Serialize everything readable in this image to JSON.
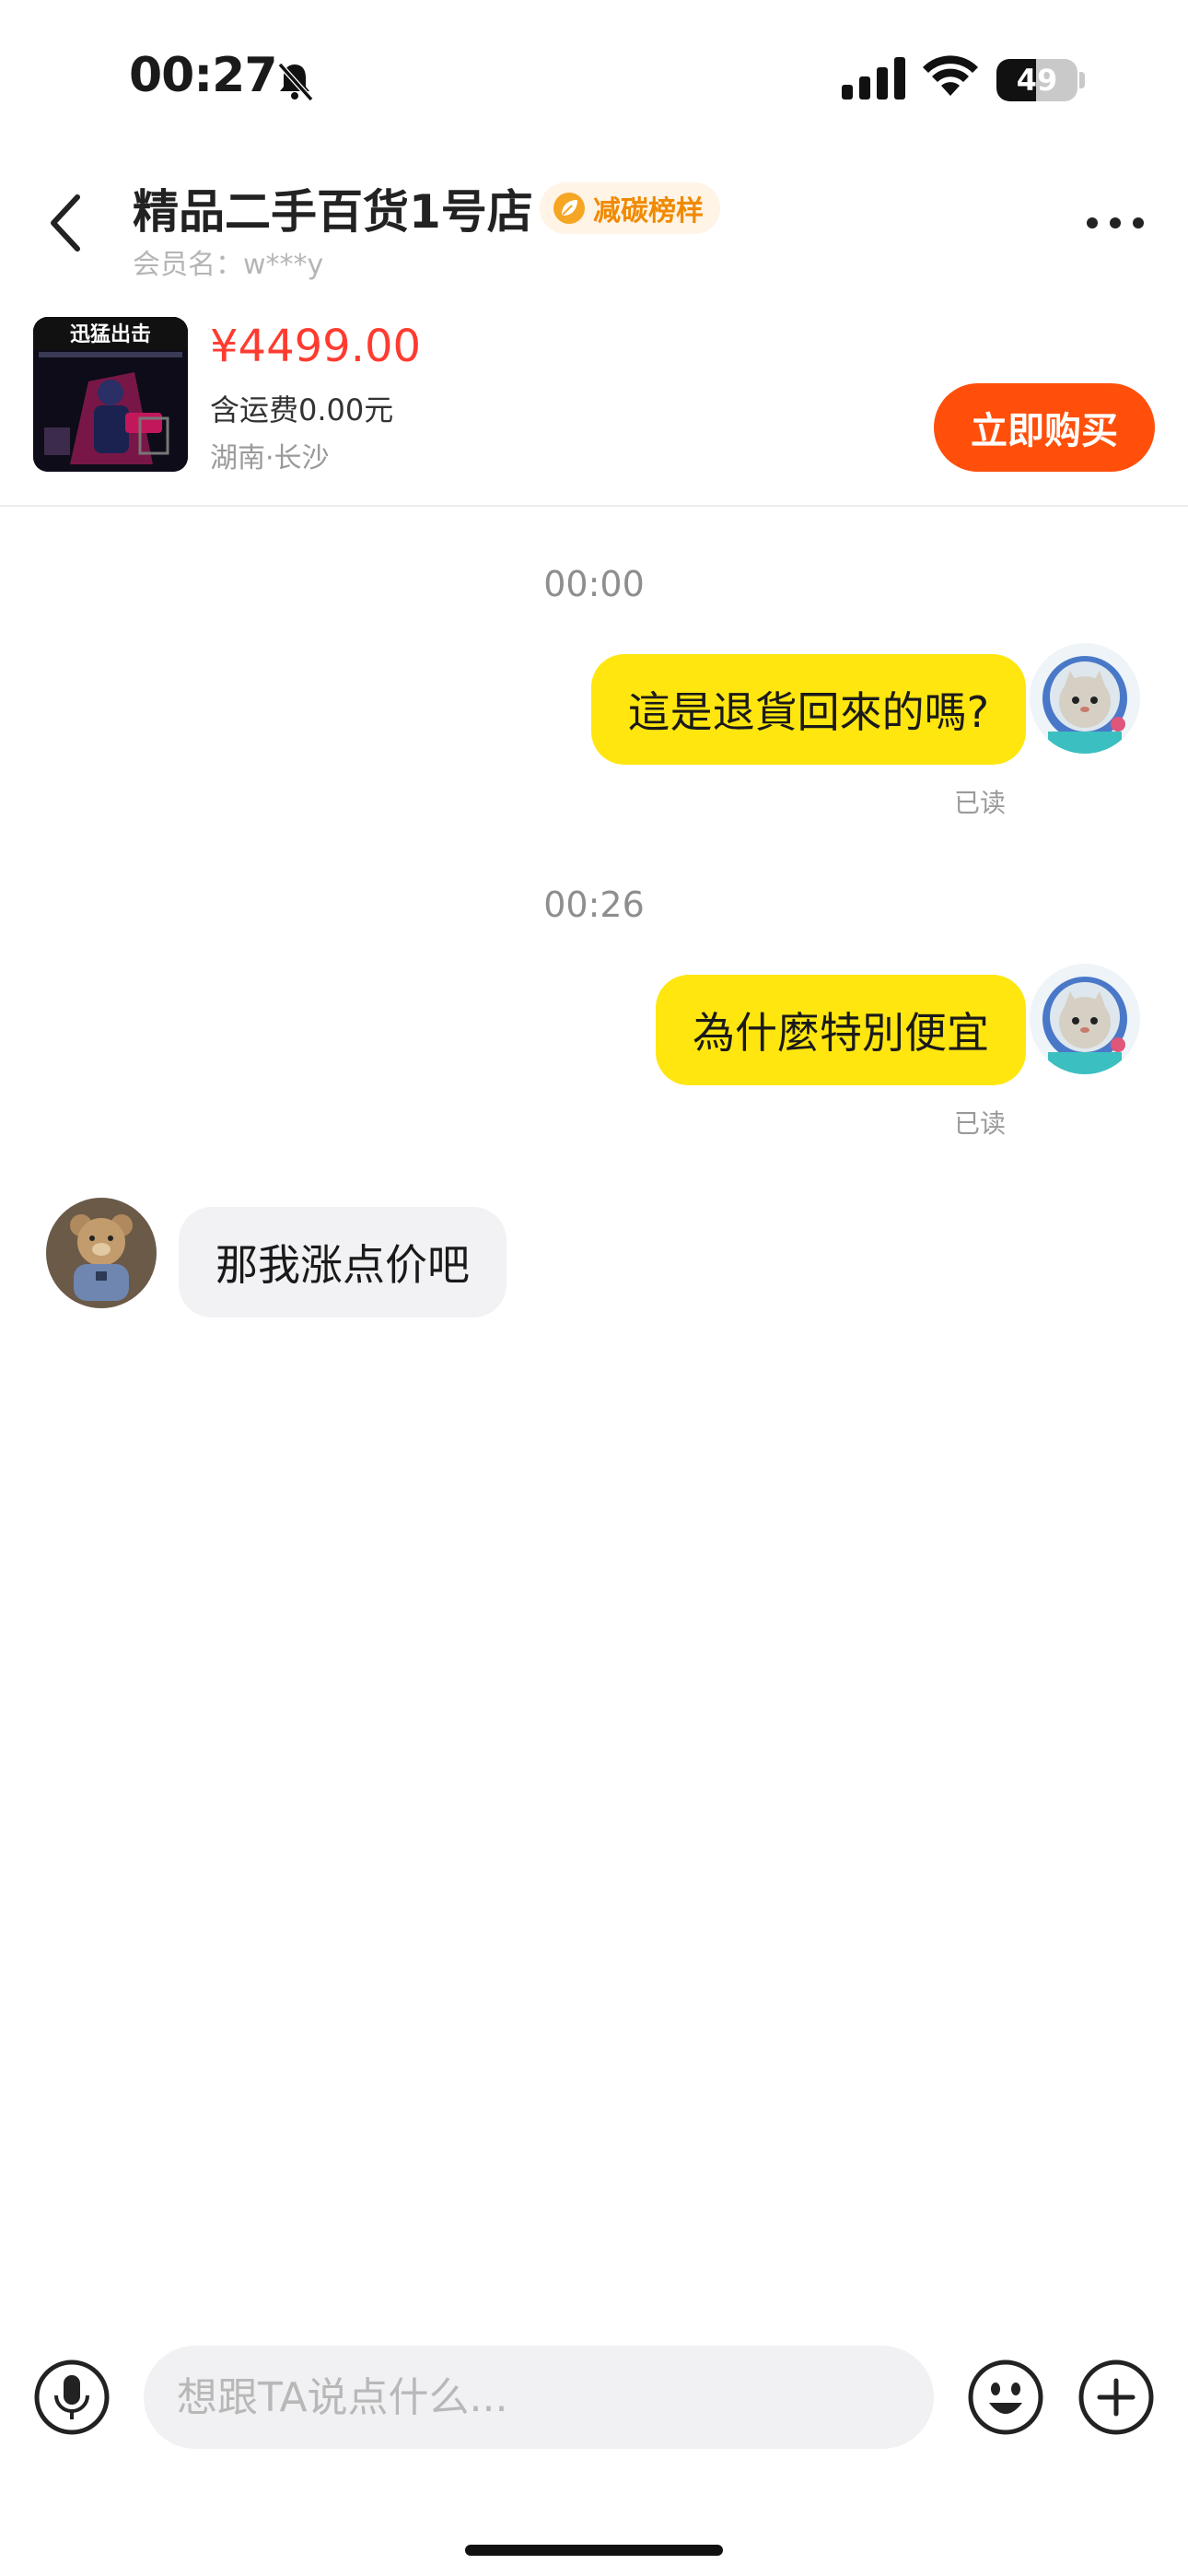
{
  "status_bar": {
    "time": "00:27",
    "battery": "49",
    "battery_level": 0.49
  },
  "header": {
    "shop_name": "精品二手百货1号店",
    "badge": "减碳榜样",
    "member": "会员名：w***y"
  },
  "product": {
    "thumb_caption": "迅猛出击",
    "price": "¥4499.00",
    "shipping": "含运费0.00元",
    "location": "湖南·长沙",
    "buy_label": "立即购买"
  },
  "messages": [
    {
      "time": "00:00",
      "text": "這是退貨回來的嗎?",
      "sender": "me",
      "status": "已读"
    },
    {
      "time": "00:26",
      "text": "為什麼特別便宜",
      "sender": "me",
      "status": "已读"
    },
    {
      "text": "那我涨点价吧",
      "sender": "them"
    }
  ],
  "input": {
    "placeholder": "想跟TA说点什么..."
  },
  "colors": {
    "accent": "#ff4f0a",
    "bubble_me": "#ffe60f",
    "bubble_them": "#f2f2f4",
    "price": "#ff3b30"
  },
  "icons": [
    "back-icon",
    "more-icon",
    "microphone-icon",
    "emoji-icon",
    "plus-icon",
    "bell-muted-icon",
    "signal-icon",
    "wifi-icon",
    "battery-icon"
  ]
}
